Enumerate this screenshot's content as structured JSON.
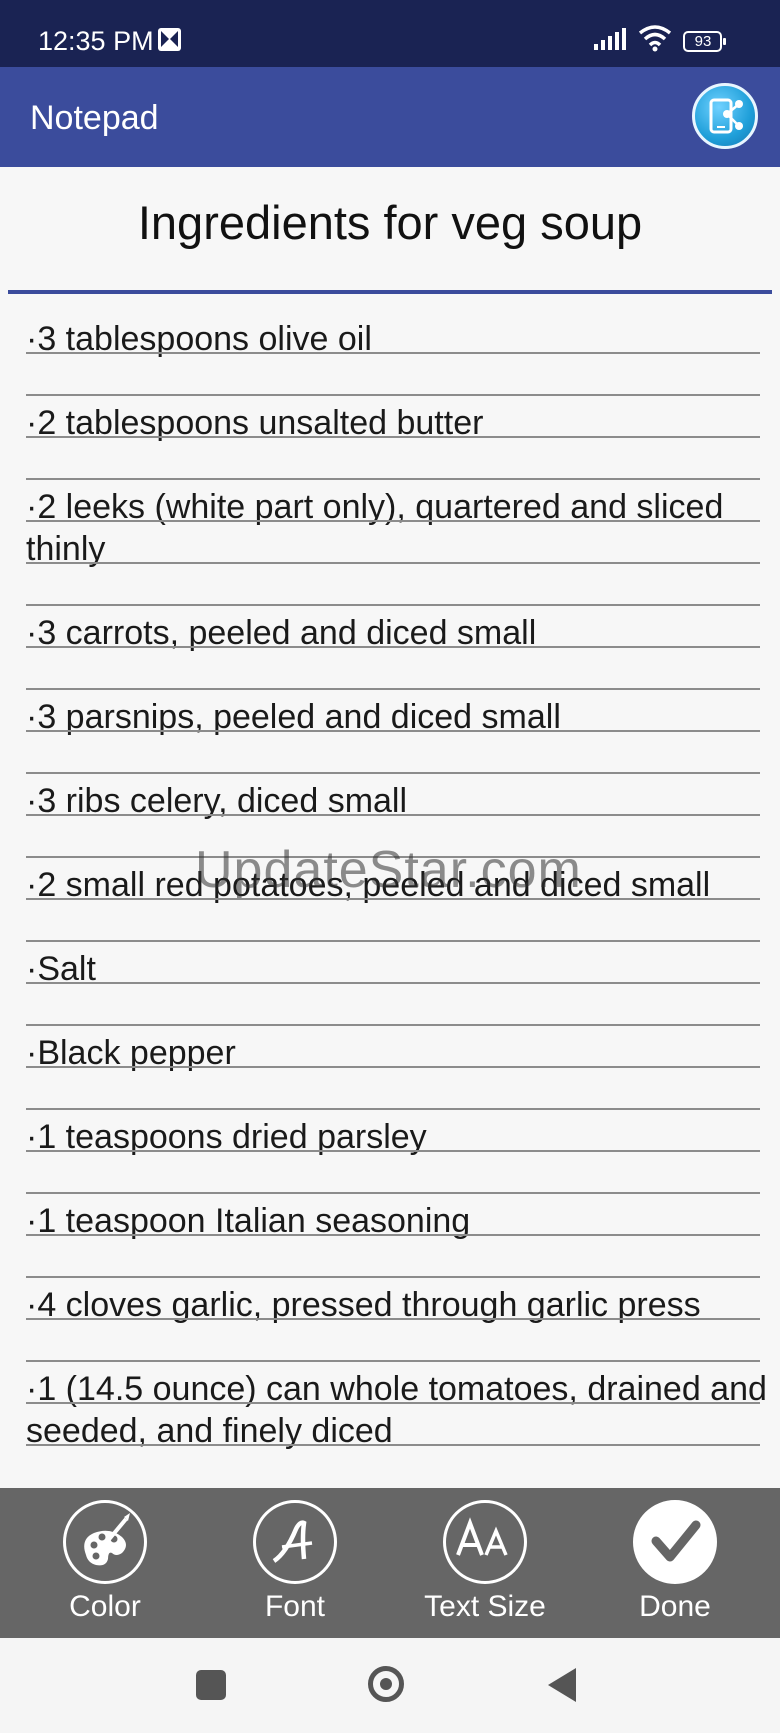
{
  "status_bar": {
    "time": "12:35 PM",
    "battery": "93"
  },
  "app_bar": {
    "title": "Notepad",
    "share_icon": "share-screen-icon"
  },
  "note": {
    "title": "Ingredients for veg soup",
    "lines": [
      "·3 tablespoons olive oil",
      "·2 tablespoons unsalted butter",
      "·2 leeks (white part only), quartered and sliced thinly",
      "·3 carrots, peeled and diced small",
      "·3 parsnips, peeled and diced small",
      "·3 ribs celery, diced small",
      "·2 small red potatoes, peeled and diced small",
      "·Salt",
      "·Black pepper",
      "·1 teaspoons dried parsley",
      "·1 teaspoon Italian seasoning",
      "·4 cloves garlic, pressed through garlic press",
      "·1 (14.5 ounce) can whole tomatoes, drained and seeded, and finely diced"
    ]
  },
  "watermark": "UpdateStar.com",
  "toolbar": {
    "color_label": "Color",
    "font_label": "Font",
    "text_size_label": "Text Size",
    "done_label": "Done"
  }
}
